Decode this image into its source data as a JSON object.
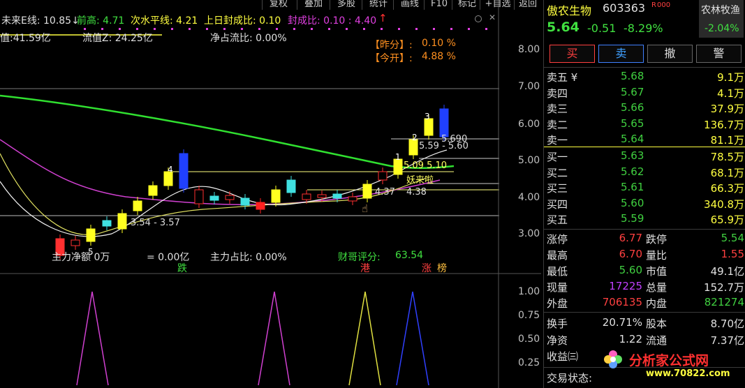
{
  "toolbar": {
    "items": [
      "复权",
      "叠加",
      "多股",
      "统计",
      "画线",
      "F10",
      "标记",
      "+自选",
      "返回"
    ]
  },
  "indicators": {
    "line1": {
      "label": "未来E线: 10.85↓",
      "prev_high": "前高: 4.71",
      "sub_level": "次水平线: 4.21",
      "prev_seal": "上日封成比: 0.10",
      "seal_ratio": "封成比: 0.10 : 4.40",
      "up_mark": "↑"
    },
    "line2": {
      "total_value": "值:41.59亿",
      "float_z": "流值Z: 24.25亿",
      "net_ratio": "净占流比: 0.00%"
    },
    "badge1": {
      "label": "【昨分】:",
      "value": "0.10 %"
    },
    "badge2": {
      "label": "【今开】:",
      "value": "4.88 %"
    },
    "bottom_row": {
      "main_in": "主力净额 0万",
      "amount": "= 0.00亿",
      "main_ratio": "主力占比: 0.00%",
      "score_label": "财哥评分:",
      "score_value": "63.54"
    },
    "tags": {
      "die": "跌",
      "gang": "港",
      "zhang": "涨",
      "bang": "榜"
    },
    "annotations": {
      "a1": "5.59 - 5.60",
      "a2": "5.690",
      "a3": "5.09 5.10",
      "a4": "妖来啦",
      "a5": "4.38",
      "a6": "4.37",
      "a7": "3.54 - 3.57",
      "n1": "1",
      "n2": "2",
      "n3": "3",
      "n4": "4",
      "n5": "5"
    }
  },
  "y_axis": {
    "main": [
      "8.00",
      "7.00",
      "6.00",
      "5.00",
      "4.00",
      "3.00"
    ],
    "sub": [
      "1.00",
      "0.75",
      "0.50",
      "0.25"
    ]
  },
  "stock": {
    "name": "傲农生物",
    "code": "603363",
    "tag": "R",
    "tag2": "000",
    "price": "5.64",
    "change": "-0.51",
    "pct": "-8.29%",
    "sector": "农林牧渔",
    "sector_pct": "-2.04%"
  },
  "actions": [
    "买",
    "卖",
    "撤",
    "警"
  ],
  "asks": [
    {
      "label": "卖五 ¥",
      "price": "5.68",
      "vol": "9.1万"
    },
    {
      "label": "卖四",
      "price": "5.67",
      "vol": "4.1万"
    },
    {
      "label": "卖三",
      "price": "5.66",
      "vol": "37.9万"
    },
    {
      "label": "卖二",
      "price": "5.65",
      "vol": "136.7万"
    },
    {
      "label": "卖一",
      "price": "5.64",
      "vol": "81.1万"
    }
  ],
  "bids": [
    {
      "label": "买一",
      "price": "5.63",
      "vol": "78.5万"
    },
    {
      "label": "买二",
      "price": "5.62",
      "vol": "68.1万"
    },
    {
      "label": "买三",
      "price": "5.61",
      "vol": "66.3万"
    },
    {
      "label": "买四",
      "price": "5.60",
      "vol": "340.8万"
    },
    {
      "label": "买五",
      "price": "5.59",
      "vol": "65.9万"
    }
  ],
  "stats": [
    {
      "l1": "涨停",
      "v1": "6.77",
      "c1": "red",
      "l2": "跌停",
      "v2": "5.54",
      "c2": "green"
    },
    {
      "l1": "最高",
      "v1": "6.70",
      "c1": "red",
      "l2": "量比",
      "v2": "1.55",
      "c2": "red"
    },
    {
      "l1": "最低",
      "v1": "5.60",
      "c1": "green",
      "l2": "市值",
      "v2": "49.1亿",
      "c2": "white"
    },
    {
      "l1": "现量",
      "v1": "17225",
      "c1": "purple",
      "l2": "总量",
      "v2": "152.7万",
      "c2": "white"
    },
    {
      "l1": "外盘",
      "v1": "706135",
      "c1": "red",
      "l2": "内盘",
      "v2": "821274",
      "c2": "green"
    }
  ],
  "stats2": [
    {
      "l1": "换手",
      "v1": "20.71%",
      "l2": "股本",
      "v2": "8.70亿"
    },
    {
      "l1": "净资",
      "v1": "1.22",
      "l2": "流通",
      "v2": "7.37亿"
    }
  ],
  "income": {
    "label": "收益㈢"
  },
  "trade_status": {
    "label": "交易状态:"
  },
  "watermark": {
    "text": "分析家公式网",
    "url": "www.70822.com"
  },
  "colors": {
    "up": "#ff3030",
    "down": "#30c030",
    "accent": "#ffff00"
  }
}
